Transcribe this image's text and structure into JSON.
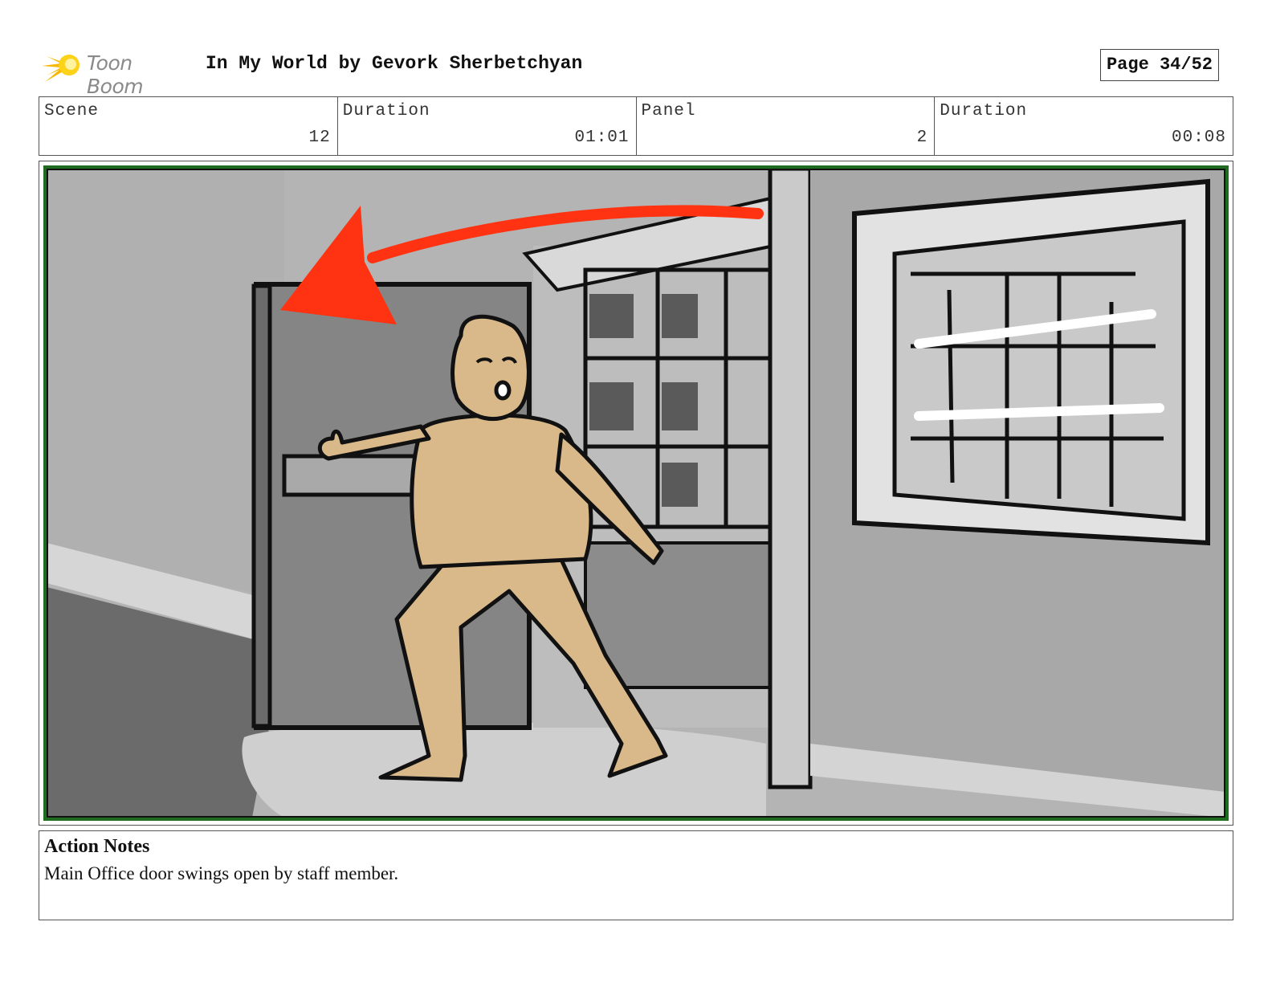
{
  "header": {
    "logo_text": "Toon Boom",
    "title": "In My World by Gevork Sherbetchyan",
    "page": "Page 34/52"
  },
  "info": {
    "scene_label": "Scene",
    "scene_value": "12",
    "scene_duration_label": "Duration",
    "scene_duration_value": "01:01",
    "panel_label": "Panel",
    "panel_value": "2",
    "panel_duration_label": "Duration",
    "panel_duration_value": "00:08"
  },
  "notes": {
    "title": "Action Notes",
    "text": "Main Office door swings open by staff member."
  },
  "colors": {
    "arrow": "#ff3311",
    "skin": "#d9b98a",
    "frame_border": "#1f6b1f"
  }
}
